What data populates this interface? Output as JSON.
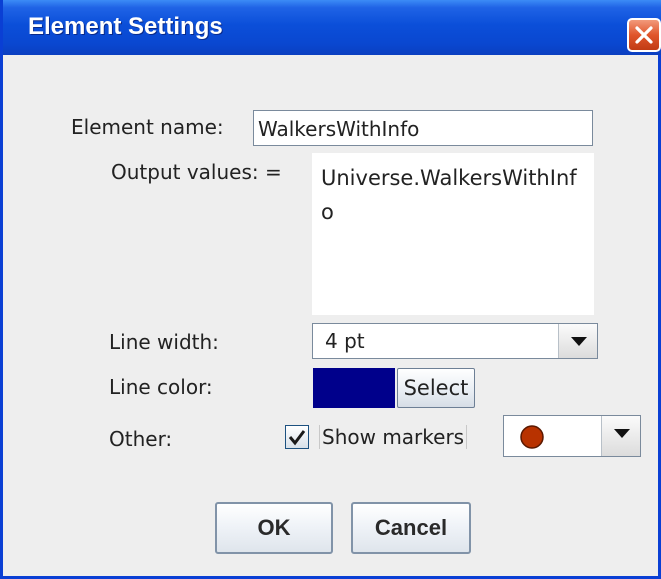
{
  "window": {
    "title": "Element Settings"
  },
  "form": {
    "element_name_label": "Element name:",
    "element_name_value": "WalkersWithInfo",
    "output_values_label": "Output values:  =",
    "output_values_text": "Universe.WalkersWithInfo",
    "line_width_label": "Line width:",
    "line_width_value": "4 pt",
    "line_color_label": "Line color:",
    "line_color_hex": "#00008b",
    "select_button_label": "Select",
    "other_label": "Other:",
    "show_markers_label": "Show markers",
    "show_markers_checked": true,
    "marker_color_hex": "#b83200",
    "marker_shape": "circle"
  },
  "buttons": {
    "ok": "OK",
    "cancel": "Cancel"
  }
}
